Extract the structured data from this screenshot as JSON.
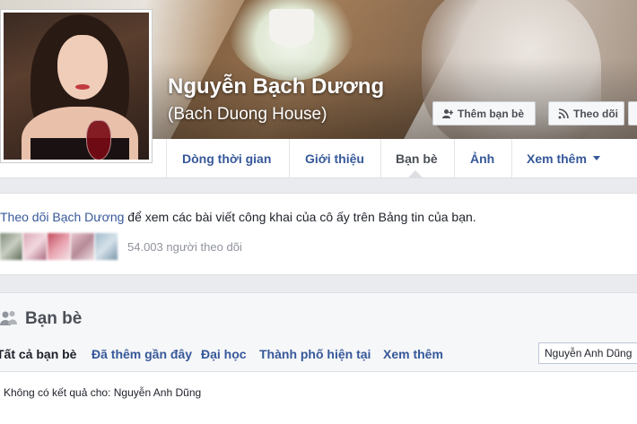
{
  "profile": {
    "name": "Nguyễn Bạch Dương",
    "alternate_name": "(Bach Duong House)"
  },
  "cover_buttons": {
    "add_friend": "Thêm bạn bè",
    "follow": "Theo dõi"
  },
  "nav": {
    "items": [
      {
        "label": "Dòng thời gian"
      },
      {
        "label": "Giới thiệu"
      },
      {
        "label": "Bạn bè"
      },
      {
        "label": "Ảnh"
      },
      {
        "label": "Xem thêm"
      }
    ]
  },
  "follow_box": {
    "link": "Theo dõi Bạch Dương",
    "text": " để xem các bài viết công khai của cô ấy trên Bảng tin của bạn.",
    "followers": "54.003 người theo dõi"
  },
  "friends": {
    "title": "Bạn bè",
    "tabs": [
      {
        "label": "Tất cả bạn bè"
      },
      {
        "label": "Đã thêm gần đây"
      },
      {
        "label": "Đại học"
      },
      {
        "label": "Thành phố hiện tại"
      },
      {
        "label": "Xem thêm"
      }
    ],
    "search_value": "Nguyễn Anh Dũng",
    "no_result": "Không có kết quả cho: Nguyễn Anh Dũng"
  },
  "colors": {
    "link": "#365899",
    "background": "#e9ebee"
  }
}
